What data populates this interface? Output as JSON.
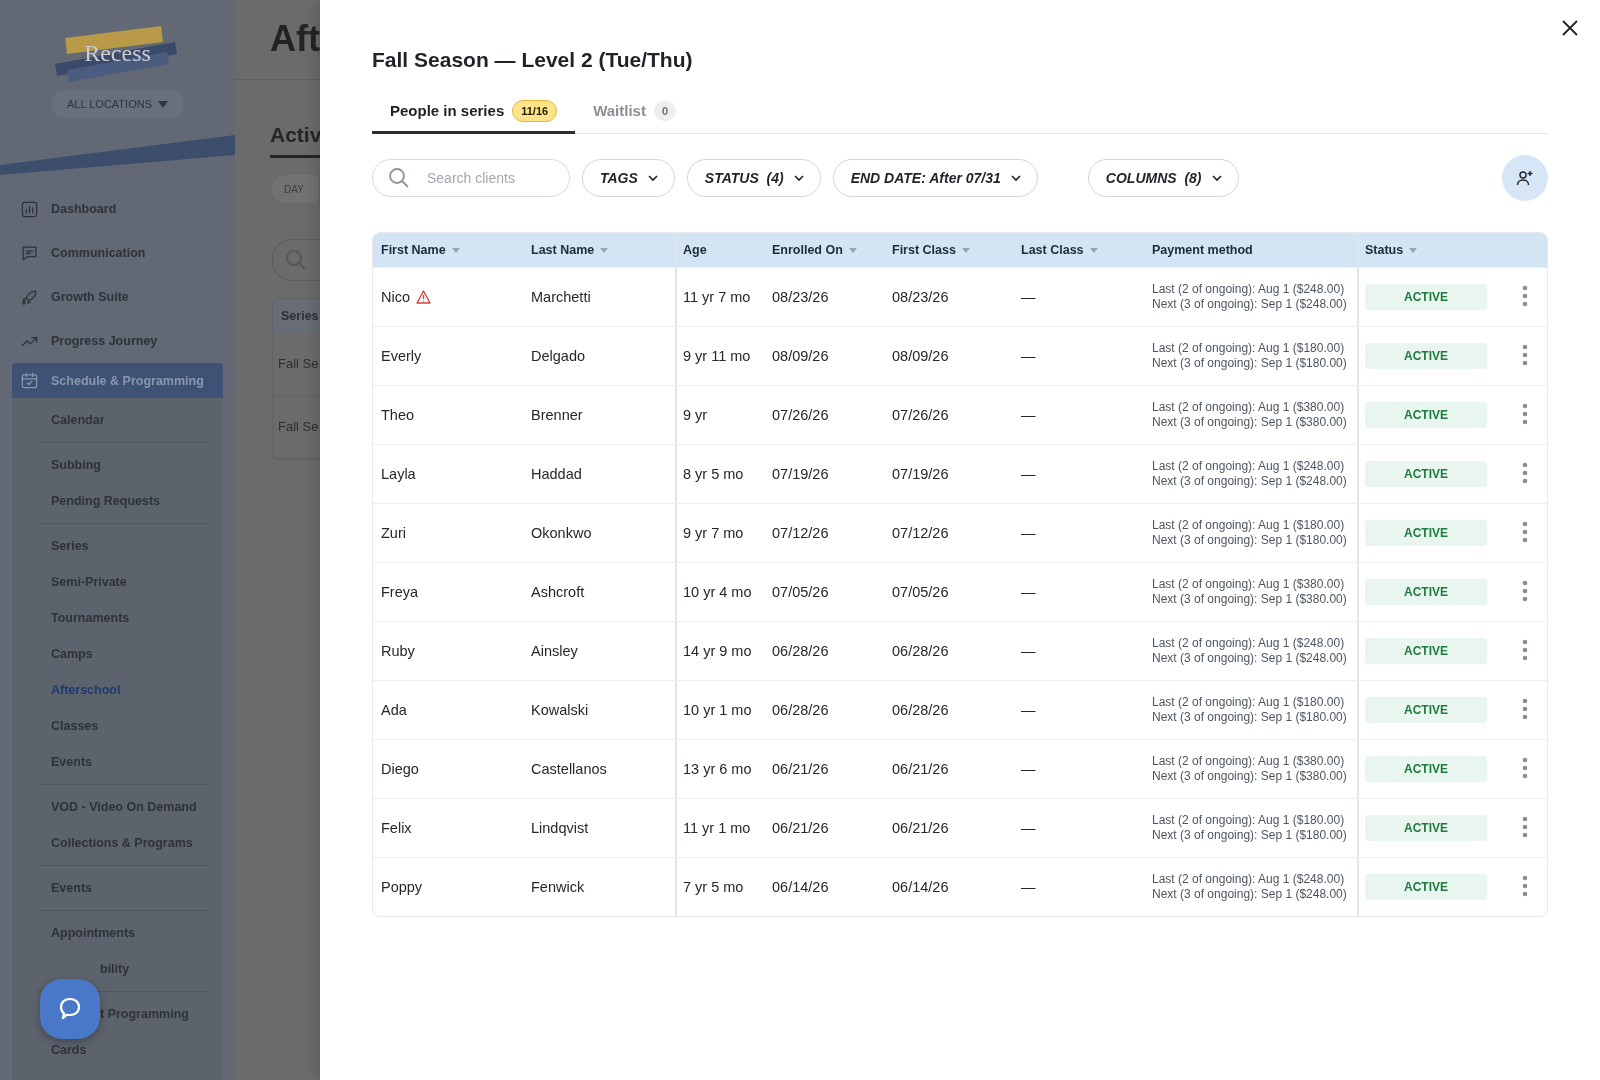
{
  "sidebar": {
    "logo_text": "Recess",
    "location_button": "ALL LOCATIONS",
    "items": [
      {
        "label": "Dashboard",
        "selected": false
      },
      {
        "label": "Communication",
        "selected": false
      },
      {
        "label": "Growth Suite",
        "selected": false
      },
      {
        "label": "Progress Journey",
        "selected": false
      },
      {
        "label": "Schedule & Programming",
        "selected": true,
        "expanded": true,
        "groups": [
          [
            {
              "label": "Calendar",
              "selected": false
            }
          ],
          [
            {
              "label": "Subbing",
              "selected": false
            },
            {
              "label": "Pending Requests",
              "selected": false
            }
          ],
          [
            {
              "label": "Series",
              "selected": false
            },
            {
              "label": "Semi-Private",
              "selected": false
            },
            {
              "label": "Tournaments",
              "selected": false
            },
            {
              "label": "Camps",
              "selected": false
            },
            {
              "label": "Afterschool",
              "selected": true
            },
            {
              "label": "Classes",
              "selected": false
            },
            {
              "label": "Events",
              "selected": false
            }
          ],
          [
            {
              "label": "VOD - Video On Demand",
              "selected": false
            },
            {
              "label": "Collections & Programs",
              "selected": false
            }
          ],
          [
            {
              "label": "Events",
              "selected": false
            }
          ],
          [
            {
              "label": "Appointments",
              "selected": false
            },
            {
              "label": "bility",
              "selected": false,
              "kind": "partial"
            }
          ],
          [
            {
              "label": "t Programming",
              "selected": false,
              "kind": "partial"
            },
            {
              "label": "Cards",
              "selected": false
            }
          ]
        ]
      }
    ]
  },
  "background_page": {
    "title": "Aft",
    "tab": "Activ",
    "view_button": "DAY",
    "table_header": "Series",
    "rows": [
      "Fall Se",
      "Fall Se"
    ]
  },
  "dialog": {
    "title": "Fall Season — Level 2 (Tue/Thu)",
    "tabs": [
      {
        "label": "People in series",
        "count": "11/16",
        "selected": true
      },
      {
        "label": "Waitlist",
        "count": "0",
        "selected": false
      }
    ],
    "search": {
      "placeholder": "Search clients"
    },
    "filters": [
      "TAGS",
      "STATUS  (4)",
      "END DATE: After 07/31",
      "COLUMNS  (8)"
    ],
    "table": {
      "columns": [
        {
          "label": "First Name",
          "sortable": true
        },
        {
          "label": "Last Name",
          "sortable": true
        },
        {
          "label": "Age",
          "sortable": false
        },
        {
          "label": "Enrolled On",
          "sortable": true
        },
        {
          "label": "First Class",
          "sortable": true
        },
        {
          "label": "Last Class",
          "sortable": true
        },
        {
          "label": "Payment method",
          "sortable": false
        },
        {
          "label": "Status",
          "sortable": true
        }
      ],
      "rows": [
        {
          "first": "Nico",
          "warning": true,
          "last": "Marchetti",
          "age": "11 yr 7 mo",
          "enrolled": "08/23/26",
          "first_class": "08/23/26",
          "last_class": "—",
          "payment_last": "Last (2 of ongoing): Aug 1 ($248.00)",
          "payment_next": "Next (3 of ongoing): Sep 1 ($248.00)",
          "status": "ACTIVE"
        },
        {
          "first": "Everly",
          "warning": false,
          "last": "Delgado",
          "age": "9 yr 11 mo",
          "enrolled": "08/09/26",
          "first_class": "08/09/26",
          "last_class": "—",
          "payment_last": "Last (2 of ongoing): Aug 1 ($180.00)",
          "payment_next": "Next (3 of ongoing): Sep 1 ($180.00)",
          "status": "ACTIVE"
        },
        {
          "first": "Theo",
          "warning": false,
          "last": "Brenner",
          "age": "9 yr",
          "enrolled": "07/26/26",
          "first_class": "07/26/26",
          "last_class": "—",
          "payment_last": "Last (2 of ongoing): Aug 1 ($380.00)",
          "payment_next": "Next (3 of ongoing): Sep 1 ($380.00)",
          "status": "ACTIVE"
        },
        {
          "first": "Layla",
          "warning": false,
          "last": "Haddad",
          "age": "8 yr 5 mo",
          "enrolled": "07/19/26",
          "first_class": "07/19/26",
          "last_class": "—",
          "payment_last": "Last (2 of ongoing): Aug 1 ($248.00)",
          "payment_next": "Next (3 of ongoing): Sep 1 ($248.00)",
          "status": "ACTIVE"
        },
        {
          "first": "Zuri",
          "warning": false,
          "last": "Okonkwo",
          "age": "9 yr 7 mo",
          "enrolled": "07/12/26",
          "first_class": "07/12/26",
          "last_class": "—",
          "payment_last": "Last (2 of ongoing): Aug 1 ($180.00)",
          "payment_next": "Next (3 of ongoing): Sep 1 ($180.00)",
          "status": "ACTIVE"
        },
        {
          "first": "Freya",
          "warning": false,
          "last": "Ashcroft",
          "age": "10 yr 4 mo",
          "enrolled": "07/05/26",
          "first_class": "07/05/26",
          "last_class": "—",
          "payment_last": "Last (2 of ongoing): Aug 1 ($380.00)",
          "payment_next": "Next (3 of ongoing): Sep 1 ($380.00)",
          "status": "ACTIVE"
        },
        {
          "first": "Ruby",
          "warning": false,
          "last": "Ainsley",
          "age": "14 yr 9 mo",
          "enrolled": "06/28/26",
          "first_class": "06/28/26",
          "last_class": "—",
          "payment_last": "Last (2 of ongoing): Aug 1 ($248.00)",
          "payment_next": "Next (3 of ongoing): Sep 1 ($248.00)",
          "status": "ACTIVE"
        },
        {
          "first": "Ada",
          "warning": false,
          "last": "Kowalski",
          "age": "10 yr 1 mo",
          "enrolled": "06/28/26",
          "first_class": "06/28/26",
          "last_class": "—",
          "payment_last": "Last (2 of ongoing): Aug 1 ($180.00)",
          "payment_next": "Next (3 of ongoing): Sep 1 ($180.00)",
          "status": "ACTIVE"
        },
        {
          "first": "Diego",
          "warning": false,
          "last": "Castellanos",
          "age": "13 yr 6 mo",
          "enrolled": "06/21/26",
          "first_class": "06/21/26",
          "last_class": "—",
          "payment_last": "Last (2 of ongoing): Aug 1 ($380.00)",
          "payment_next": "Next (3 of ongoing): Sep 1 ($380.00)",
          "status": "ACTIVE"
        },
        {
          "first": "Felix",
          "warning": false,
          "last": "Lindqvist",
          "age": "11 yr 1 mo",
          "enrolled": "06/21/26",
          "first_class": "06/21/26",
          "last_class": "—",
          "payment_last": "Last (2 of ongoing): Aug 1 ($180.00)",
          "payment_next": "Next (3 of ongoing): Sep 1 ($180.00)",
          "status": "ACTIVE"
        },
        {
          "first": "Poppy",
          "warning": false,
          "last": "Fenwick",
          "age": "7 yr 5 mo",
          "enrolled": "06/14/26",
          "first_class": "06/14/26",
          "last_class": "—",
          "payment_last": "Last (2 of ongoing): Aug 1 ($248.00)",
          "payment_next": "Next (3 of ongoing): Sep 1 ($248.00)",
          "status": "ACTIVE"
        }
      ]
    }
  }
}
